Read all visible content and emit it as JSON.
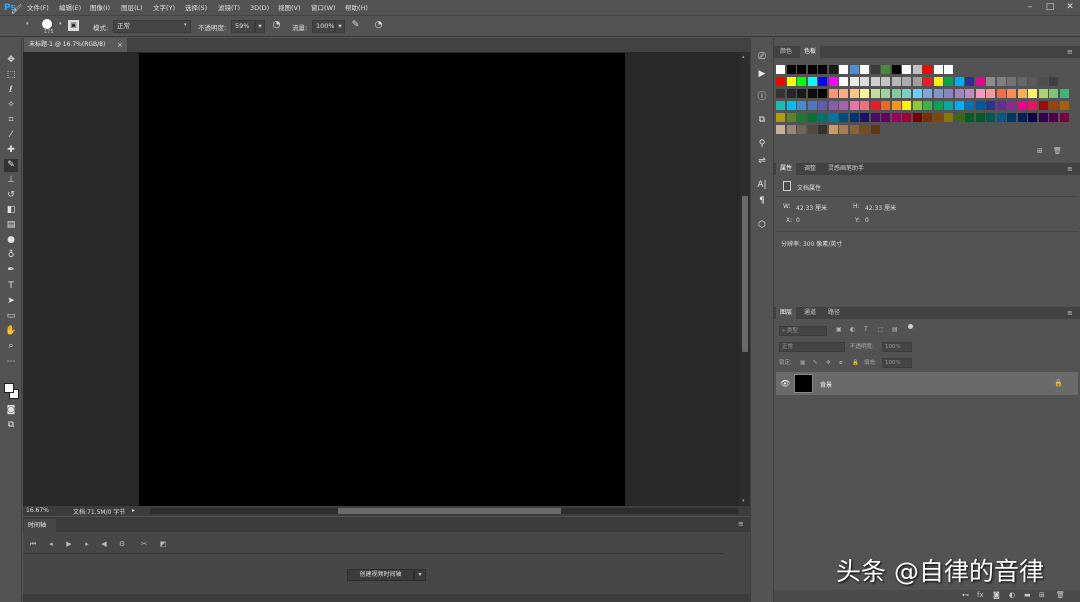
{
  "app": {
    "logo": "Ps"
  },
  "menu": [
    "文件(F)",
    "编辑(E)",
    "图像(I)",
    "图层(L)",
    "文字(Y)",
    "选择(S)",
    "滤镜(T)",
    "3D(D)",
    "视图(V)",
    "窗口(W)",
    "帮助(H)"
  ],
  "window_controls": {
    "minimize": "–",
    "maximize": "□",
    "close": "✕"
  },
  "options": {
    "brush_size": "175",
    "mode_label": "模式:",
    "mode_value": "正常",
    "opacity_label": "不透明度:",
    "opacity_value": "59%",
    "flow_label": "流量:",
    "flow_value": "100%"
  },
  "document": {
    "tab_title": "未标题-1 @ 16.7%(RGB/8)",
    "canvas_color": "#000000"
  },
  "status": {
    "zoom": "16.67%",
    "doc_info": "文档:71.5M/0 字节"
  },
  "timeline": {
    "tab": "时间轴",
    "create_button": "创建视频时间轴"
  },
  "color_panel": {
    "tabs": [
      "颜色",
      "色板"
    ],
    "active_tab": "色板",
    "swatch_rows": [
      [
        "#ffffff",
        "#000000",
        "#000000",
        "#000000",
        "#000000",
        "#1a1a1a",
        "#ffffff",
        "#4d8fd1",
        "#ffffff",
        "#3a3a3a",
        "#4a8a3a",
        "#000000",
        "#ffffff",
        "#c0c0c0",
        "#ff0000",
        "#ffffff",
        "#ffffff"
      ],
      [
        "#ff0000",
        "#ffff00",
        "#00ff00",
        "#00ffff",
        "#0000ff",
        "#ff00ff",
        "#ffffff",
        "#eaeaea",
        "#dddddd",
        "#d0d0d0",
        "#c4c4c4",
        "#b8b8b8",
        "#ababab",
        "#9f9f9f",
        "#ed1c24",
        "#fff200",
        "#00a651",
        "#00aeef",
        "#2e3192",
        "#ec008c",
        "#8c8c8c",
        "#7f7f7f",
        "#737373",
        "#666666",
        "#5a5a5a",
        "#4d4d4d",
        "#404040"
      ],
      [
        "#333333",
        "#262626",
        "#1a1a1a",
        "#0d0d0d",
        "#000000",
        "#f7977a",
        "#f9ad81",
        "#fdc68a",
        "#fff79a",
        "#c4df9b",
        "#a3d39c",
        "#82ca9d",
        "#7bcdc8",
        "#6ecff6",
        "#7ea7d8",
        "#8493ca",
        "#8882be",
        "#a187be",
        "#bc8dbf",
        "#f49ac2",
        "#f6989d",
        "#f26c4f",
        "#f68e55",
        "#fbaf5c",
        "#fff467",
        "#acd372",
        "#7cc576",
        "#3bb878"
      ],
      [
        "#1abbb4",
        "#00bff3",
        "#438ccb",
        "#5574b9",
        "#605ca8",
        "#855fa8",
        "#a763a8",
        "#f06ea9",
        "#f26d7d",
        "#ed1c24",
        "#f26522",
        "#f7941d",
        "#fff200",
        "#8dc63f",
        "#39b54a",
        "#00a651",
        "#00a99d",
        "#00aeef",
        "#0072bc",
        "#0054a6",
        "#2e3192",
        "#662d91",
        "#92278f",
        "#ec008c",
        "#ed145b",
        "#9e0b0f",
        "#a0410d",
        "#a36209"
      ],
      [
        "#aba000",
        "#598527",
        "#1a7b30",
        "#007236",
        "#00746b",
        "#0076a3",
        "#004b80",
        "#003471",
        "#1b1464",
        "#440e62",
        "#630460",
        "#9e005d",
        "#9e0039",
        "#790000",
        "#7b2e00",
        "#7d4900",
        "#827b00",
        "#406618",
        "#005e20",
        "#005826",
        "#005952",
        "#005b7f",
        "#003663",
        "#002157",
        "#0d004c",
        "#32004b",
        "#4b0049",
        "#7b0046"
      ],
      [
        "#c7b299",
        "#998675",
        "#736357",
        "#534741",
        "#37302d",
        "#c69c6d",
        "#a67c52",
        "#8c6239",
        "#754c24",
        "#603913"
      ]
    ]
  },
  "properties_panel": {
    "tabs": [
      "属性",
      "调整",
      "灵感画笔助手"
    ],
    "active_tab": "属性",
    "heading": "文档属性",
    "w_label": "W:",
    "w_value": "42.33 厘米",
    "h_label": "H:",
    "h_value": "42.33 厘米",
    "x_label": "X:",
    "x_value": "0",
    "y_label": "Y:",
    "y_value": "0",
    "resolution": "分辨率: 300 像素/英寸"
  },
  "layers_panel": {
    "tabs": [
      "图层",
      "通道",
      "路径"
    ],
    "active_tab": "图层",
    "kind_filter": "类型",
    "blend_mode": "正常",
    "opacity_label": "不透明度:",
    "opacity_value": "100%",
    "lock_label": "锁定:",
    "fill_label": "填充:",
    "fill_value": "100%",
    "layer_name": "背景"
  },
  "watermark": "头条 @自律的音律",
  "colors": {
    "ps_blue": "#31a8ff",
    "canvas": "#000000",
    "workspace": "#282828",
    "ui": "#535353"
  }
}
